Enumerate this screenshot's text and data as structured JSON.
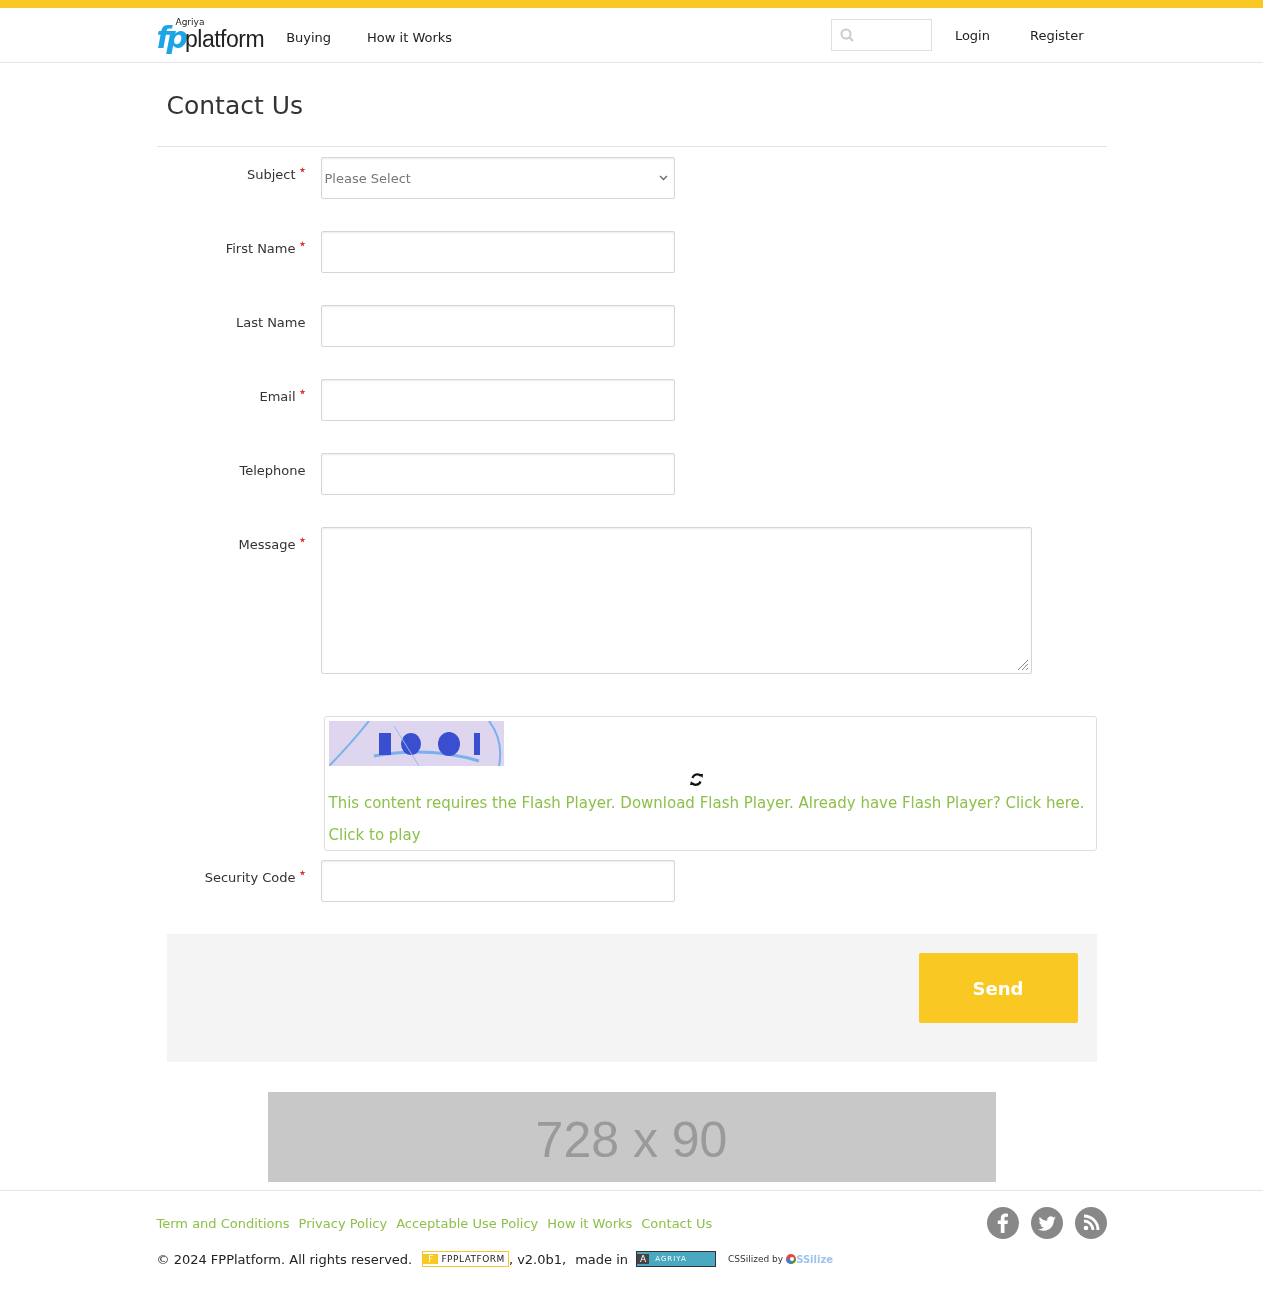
{
  "header": {
    "logo": {
      "tag": "Agriya",
      "mark": "fp",
      "word": "platform"
    },
    "nav": [
      {
        "label": "Buying"
      },
      {
        "label": "How it Works"
      }
    ],
    "account_links": [
      {
        "label": "Login"
      },
      {
        "label": "Register"
      }
    ]
  },
  "page_title": "Contact Us",
  "fields": [
    {
      "kind": "select",
      "label": "Subject",
      "required": true,
      "value": "Please Select"
    },
    {
      "kind": "text",
      "label": "First Name",
      "required": true
    },
    {
      "kind": "text",
      "label": "Last Name",
      "required": false
    },
    {
      "kind": "text",
      "label": "Email",
      "required": true
    },
    {
      "kind": "text",
      "label": "Telephone",
      "required": false
    },
    {
      "kind": "textarea",
      "label": "Message",
      "required": true
    },
    {
      "kind": "captcha",
      "flash_message": "This content requires the Flash Player. Download Flash Player. Already have Flash Player? Click here.",
      "play_label": "Click to play"
    },
    {
      "kind": "text",
      "label": "Security Code",
      "required": true
    }
  ],
  "send_button": "Send",
  "ad": "728 x 90",
  "footer": {
    "links": [
      "Term and Conditions",
      "Privacy Policy",
      "Acceptable Use Policy",
      "How it Works",
      "Contact Us"
    ],
    "copyright": "© 2024 FPPlatform. All rights reserved.",
    "product_badge": {
      "initial": "F",
      "name": "FPPLATFORM"
    },
    "version": ", v2.0b1,",
    "made_in": "made in",
    "maker_badge": {
      "initial": "A",
      "name": "AGRIYA"
    },
    "css_credit": "CSSilized by",
    "css_logo": "SSilize"
  }
}
